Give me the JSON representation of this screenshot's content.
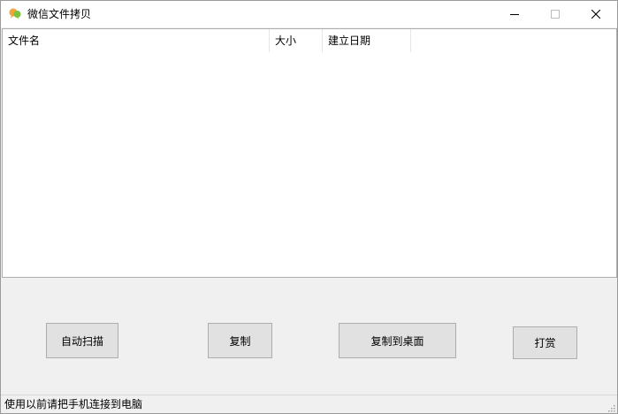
{
  "window": {
    "title": "微信文件拷贝",
    "app_icon": "two-bubble-icon",
    "controls": [
      "minimize-icon",
      "maximize-icon",
      "close-icon"
    ]
  },
  "list": {
    "columns": [
      "文件名",
      "大小",
      "建立日期"
    ],
    "rows": []
  },
  "buttons": {
    "auto_scan": "自动扫描",
    "copy": "复制",
    "copy_to_desktop": "复制到桌面",
    "tip": "打赏"
  },
  "status": {
    "text": "使用以前请把手机连接到电脑"
  },
  "colors": {
    "titlebar_bg": "#ffffff",
    "window_bg": "#f0f0f0",
    "button_bg": "#e1e1e1",
    "border": "#adadad"
  }
}
